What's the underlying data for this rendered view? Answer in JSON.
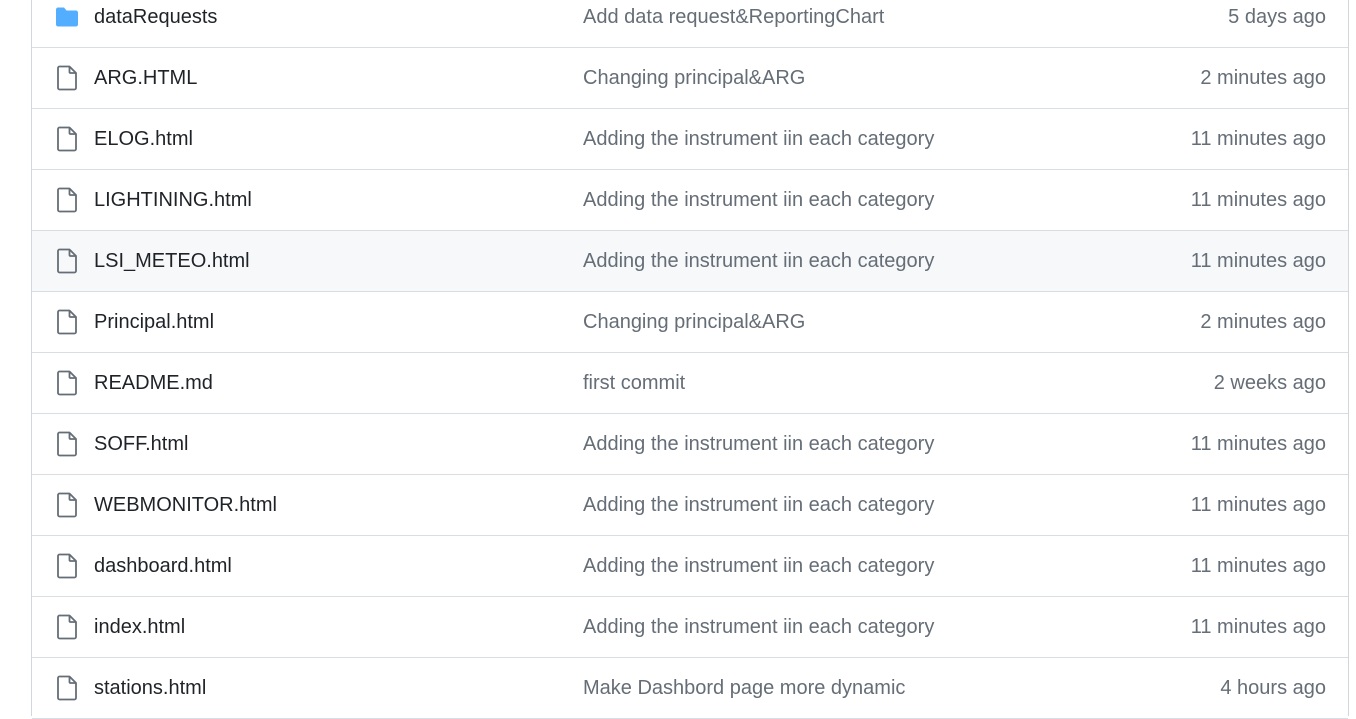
{
  "colors": {
    "folder_icon": "#54aeff",
    "file_icon": "#656d76",
    "name_text": "#1f2328",
    "muted_text": "#656d76",
    "border": "#d8dee4",
    "hover_row": "#f6f8fa"
  },
  "files": [
    {
      "type": "folder",
      "icon": "folder-icon",
      "name": "dataRequests",
      "message": "Add data request&ReportingChart",
      "time": "5 days ago"
    },
    {
      "type": "file",
      "icon": "file-icon",
      "name": "ARG.HTML",
      "message": "Changing principal&ARG",
      "time": "2 minutes ago"
    },
    {
      "type": "file",
      "icon": "file-icon",
      "name": "ELOG.html",
      "message": "Adding the instrument iin each category",
      "time": "11 minutes ago"
    },
    {
      "type": "file",
      "icon": "file-icon",
      "name": "LIGHTINING.html",
      "message": "Adding the instrument iin each category",
      "time": "11 minutes ago"
    },
    {
      "type": "file",
      "icon": "file-icon",
      "name": "LSI_METEO.html",
      "message": "Adding the instrument iin each category",
      "time": "11 minutes ago",
      "hovered": true
    },
    {
      "type": "file",
      "icon": "file-icon",
      "name": "Principal.html",
      "message": "Changing principal&ARG",
      "time": "2 minutes ago"
    },
    {
      "type": "file",
      "icon": "file-icon",
      "name": "README.md",
      "message": "first commit",
      "time": "2 weeks ago"
    },
    {
      "type": "file",
      "icon": "file-icon",
      "name": "SOFF.html",
      "message": "Adding the instrument iin each category",
      "time": "11 minutes ago"
    },
    {
      "type": "file",
      "icon": "file-icon",
      "name": "WEBMONITOR.html",
      "message": "Adding the instrument iin each category",
      "time": "11 minutes ago"
    },
    {
      "type": "file",
      "icon": "file-icon",
      "name": "dashboard.html",
      "message": "Adding the instrument iin each category",
      "time": "11 minutes ago"
    },
    {
      "type": "file",
      "icon": "file-icon",
      "name": "index.html",
      "message": "Adding the instrument iin each category",
      "time": "11 minutes ago"
    },
    {
      "type": "file",
      "icon": "file-icon",
      "name": "stations.html",
      "message": "Make Dashbord page more dynamic",
      "time": "4 hours ago"
    }
  ]
}
